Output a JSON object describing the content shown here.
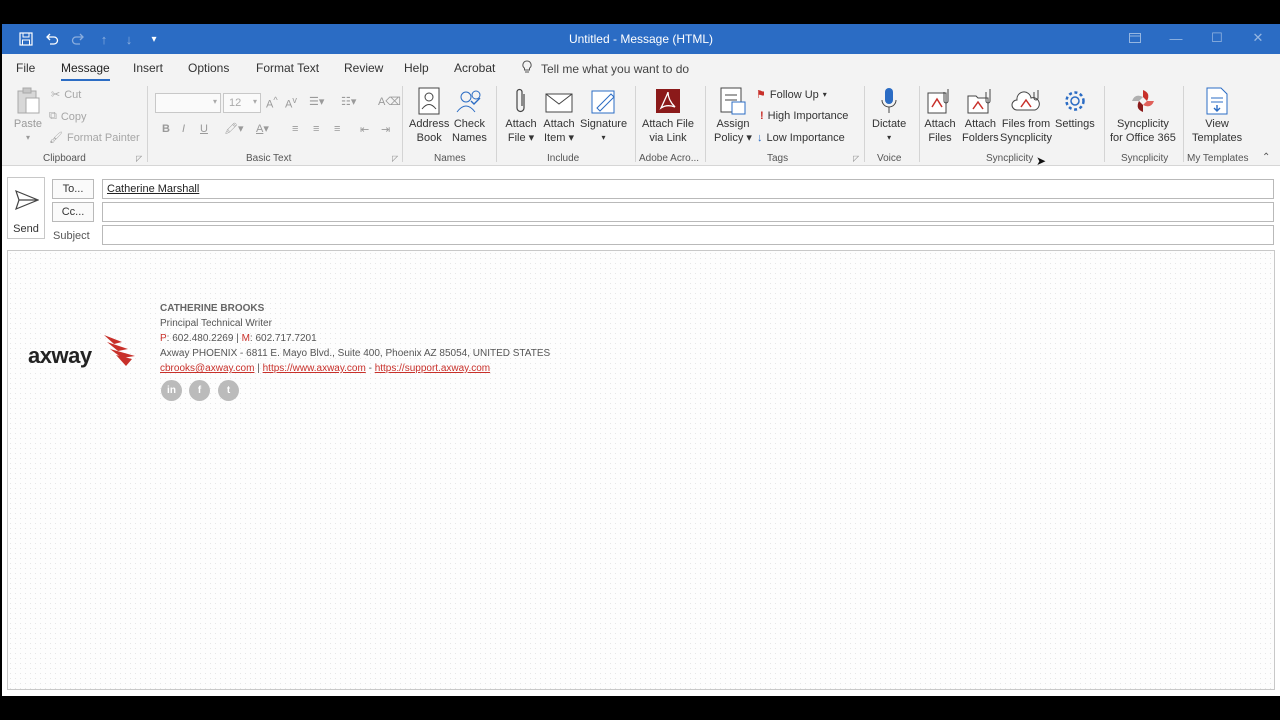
{
  "window": {
    "title": "Untitled  -  Message (HTML)"
  },
  "menu": {
    "tabs": [
      "File",
      "Message",
      "Insert",
      "Options",
      "Format Text",
      "Review",
      "Help",
      "Acrobat"
    ],
    "tell_me": "Tell me what you want to do"
  },
  "ribbon": {
    "clipboard": {
      "label": "Clipboard",
      "paste": "Paste",
      "cut": "Cut",
      "copy": "Copy",
      "format_painter": "Format Painter"
    },
    "basic_text": {
      "label": "Basic Text",
      "font_size": "12",
      "bold": "B",
      "italic": "I",
      "underline": "U"
    },
    "names": {
      "label": "Names",
      "address_book": [
        "Address",
        "Book"
      ],
      "check_names": [
        "Check",
        "Names"
      ]
    },
    "include": {
      "label": "Include",
      "attach_file": [
        "Attach",
        "File"
      ],
      "attach_item": [
        "Attach",
        "Item"
      ],
      "signature": "Signature"
    },
    "adobe": {
      "label": "Adobe Acro...",
      "attach_file_link": [
        "Attach File",
        "via Link"
      ]
    },
    "tags": {
      "label": "Tags",
      "assign_policy": [
        "Assign",
        "Policy"
      ],
      "follow_up": "Follow Up",
      "high_importance": "High Importance",
      "low_importance": "Low Importance"
    },
    "voice": {
      "label": "Voice",
      "dictate": "Dictate"
    },
    "syncplicity": {
      "label": "Syncplicity",
      "attach_files": [
        "Attach",
        "Files"
      ],
      "attach_folders": [
        "Attach",
        "Folders"
      ],
      "files_from": [
        "Files from",
        "Syncplicity"
      ],
      "settings": "Settings"
    },
    "syncplicity2": {
      "label": "Syncplicity",
      "office365": [
        "Syncplicity",
        "for Office 365"
      ]
    },
    "templates": {
      "label": "My Templates",
      "view": [
        "View",
        "Templates"
      ]
    }
  },
  "header": {
    "send": "Send",
    "to_button": "To...",
    "cc_button": "Cc...",
    "subject_label": "Subject",
    "to_value": "Catherine Marshall",
    "cc_value": "",
    "subject_value": ""
  },
  "signature": {
    "logo_text": "axway",
    "name": "CATHERINE BROOKS",
    "role": "Principal Technical Writer",
    "phone_label": "P",
    "phone": ": 602.480.2269 | ",
    "mobile_label": "M",
    "mobile": ": 602.717.7201",
    "address": "Axway PHOENIX - 6811 E. Mayo Blvd., Suite 400, Phoenix AZ 85054, UNITED STATES",
    "email": "cbrooks@axway.com",
    "sep1": " | ",
    "website": "https://www.axway.com",
    "sep2": " - ",
    "support": "https://support.axway.com",
    "social": [
      "in",
      "f",
      "t"
    ]
  },
  "colors": {
    "titlebar": "#2b6cc4",
    "accent_red": "#c8302a"
  }
}
